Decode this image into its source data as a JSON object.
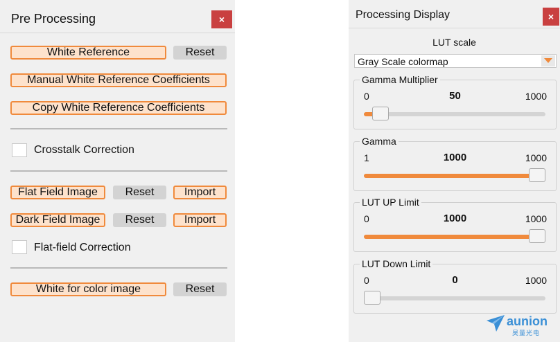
{
  "pre_processing": {
    "title": "Pre Processing",
    "close": "×",
    "white_reference": "White Reference",
    "white_reference_reset": "Reset",
    "manual_coefficients": "Manual White Reference Coefficients",
    "copy_coefficients": "Copy White Reference Coefficients",
    "crosstalk_label": "Crosstalk Correction",
    "flat_field_image": "Flat Field Image",
    "flat_field_reset": "Reset",
    "flat_field_import": "Import",
    "dark_field_image": "Dark Field Image",
    "dark_field_reset": "Reset",
    "dark_field_import": "Import",
    "flat_field_correction_label": "Flat-field Correction",
    "white_for_color": "White for color image",
    "white_for_color_reset": "Reset"
  },
  "processing_display": {
    "title": "Processing Display",
    "close": "×",
    "lut_scale_label": "LUT scale",
    "colormap_selected": "Gray Scale colormap",
    "sliders": [
      {
        "label": "Gamma Multiplier",
        "min": "0",
        "value": "50",
        "max": "1000",
        "fraction": 0.05
      },
      {
        "label": "Gamma",
        "min": "1",
        "value": "1000",
        "max": "1000",
        "fraction": 1.0
      },
      {
        "label": "LUT UP Limit",
        "min": "0",
        "value": "1000",
        "max": "1000",
        "fraction": 1.0
      },
      {
        "label": "LUT Down Limit",
        "min": "0",
        "value": "0",
        "max": "1000",
        "fraction": 0.0
      }
    ],
    "logo": {
      "word": "aunion",
      "sub": "昊量光电"
    }
  },
  "colors": {
    "accent": "#f08a3c",
    "accent_light": "#fde2cc",
    "close_red": "#c94040",
    "logo_blue": "#3a8fd6"
  },
  "icons": {
    "close": "close-icon",
    "dropdown": "chevron-down-icon",
    "logo": "paper-plane-logo-icon"
  }
}
